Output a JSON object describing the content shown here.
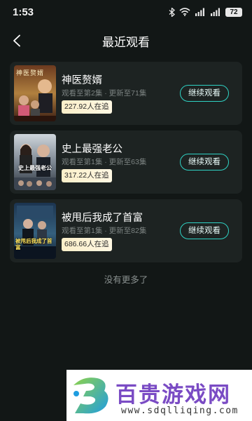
{
  "status_bar": {
    "time": "1:53",
    "battery": "72",
    "icons": [
      "bluetooth-icon",
      "wifi-icon",
      "signal-icon",
      "signal-icon",
      "battery-icon"
    ]
  },
  "header": {
    "title": "最近观看",
    "back_icon": "chevron-left-icon"
  },
  "history": [
    {
      "title": "神医赘婿",
      "progress": "观看至第2集 · 更新至71集",
      "viewers": "227.92人在追",
      "button": "继续观看",
      "poster_text": "神医赘婿"
    },
    {
      "title": "史上最强老公",
      "progress": "观看至第1集 · 更新至63集",
      "viewers": "317.22人在追",
      "button": "继续观看",
      "poster_text": "史上最强老公"
    },
    {
      "title": "被甩后我成了首富",
      "progress": "观看至第1集 · 更新至82集",
      "viewers": "686.66人在追",
      "button": "继续观看",
      "poster_text": "被甩后我成了首富"
    }
  ],
  "footer": {
    "no_more": "没有更多了"
  },
  "watermark": {
    "brand": "百贵游戏网",
    "url": "www.sdqlliqing.com"
  },
  "colors": {
    "background": "#121716",
    "card": "#1d2322",
    "accent": "#2fd2c4",
    "badge": "#fbefc9",
    "watermark_purple": "#7a4bc4"
  }
}
